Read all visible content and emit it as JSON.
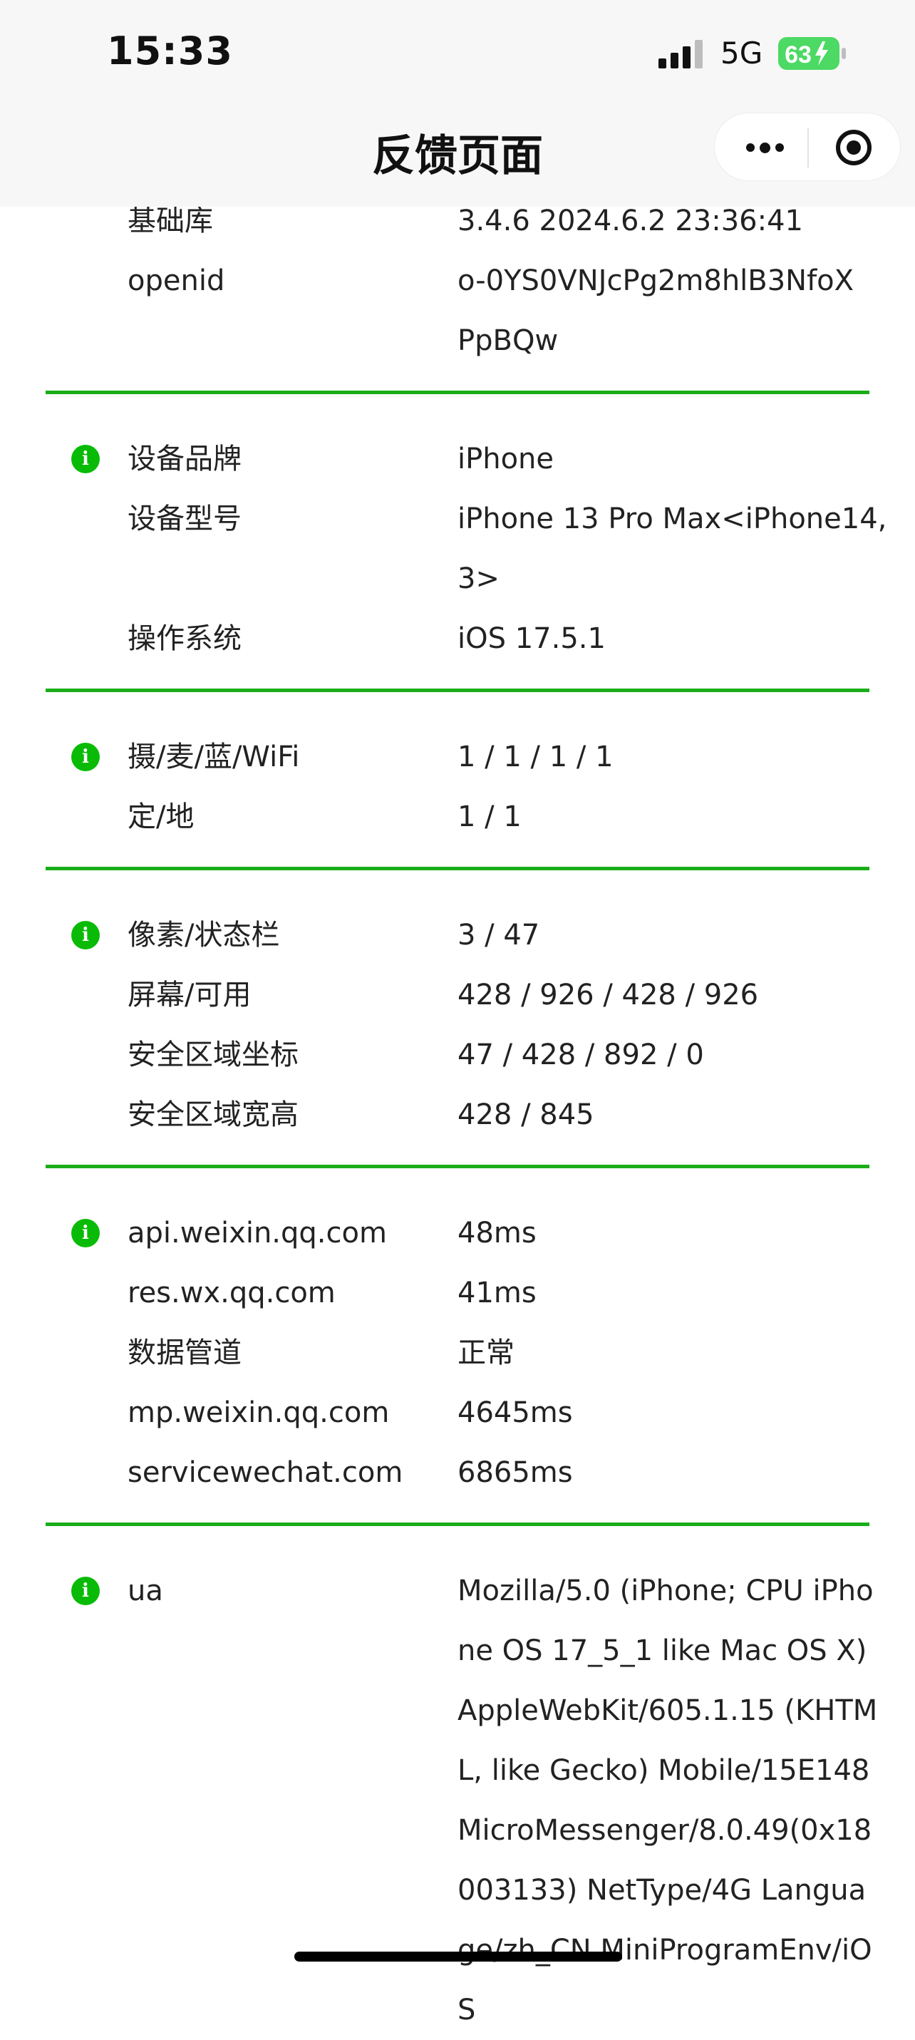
{
  "status_bar": {
    "time": "15:33",
    "network": "5G",
    "battery": "63"
  },
  "nav": {
    "title": "反馈页面"
  },
  "sections": [
    {
      "rows": [
        {
          "label": "基础库",
          "value_lines": [
            "3.4.6 2024.6.2 23:36:41"
          ]
        },
        {
          "label": "openid",
          "value_lines": [
            "o-0YS0VNJcPg2m8hlB3NfoX",
            "PpBQw"
          ]
        }
      ]
    },
    {
      "rows": [
        {
          "label": "设备品牌",
          "value_lines": [
            "iPhone"
          ]
        },
        {
          "label": "设备型号",
          "value_lines": [
            "iPhone 13 Pro Max<iPhone14,",
            "3>"
          ]
        },
        {
          "label": "操作系统",
          "value_lines": [
            "iOS 17.5.1"
          ]
        }
      ]
    },
    {
      "rows": [
        {
          "label": "摄/麦/蓝/WiFi",
          "value_lines": [
            "1 / 1 / 1 / 1"
          ]
        },
        {
          "label": "定/地",
          "value_lines": [
            "1 / 1"
          ]
        }
      ]
    },
    {
      "rows": [
        {
          "label": "像素/状态栏",
          "value_lines": [
            "3 / 47"
          ]
        },
        {
          "label": "屏幕/可用",
          "value_lines": [
            "428 / 926 / 428 / 926"
          ]
        },
        {
          "label": "安全区域坐标",
          "value_lines": [
            "47 / 428 / 892 / 0"
          ]
        },
        {
          "label": "安全区域宽高",
          "value_lines": [
            "428 / 845"
          ]
        }
      ]
    },
    {
      "rows": [
        {
          "label": "api.weixin.qq.com",
          "value_lines": [
            "48ms"
          ]
        },
        {
          "label": "res.wx.qq.com",
          "value_lines": [
            "41ms"
          ]
        },
        {
          "label": "数据管道",
          "value_lines": [
            "正常"
          ]
        },
        {
          "label": "mp.weixin.qq.com",
          "value_lines": [
            "4645ms"
          ]
        },
        {
          "label": "servicewechat.com",
          "value_lines": [
            "6865ms"
          ]
        }
      ]
    },
    {
      "rows": [
        {
          "label": "ua",
          "value_lines": [
            "Mozilla/5.0 (iPhone; CPU iPho",
            "ne OS 17_5_1 like Mac OS X)",
            "AppleWebKit/605.1.15 (KHTM",
            "L, like Gecko) Mobile/15E148",
            "MicroMessenger/8.0.49(0x18",
            "003133) NetType/4G Langua",
            "ge/zh_CN MiniProgramEnv/iO",
            "S"
          ]
        }
      ]
    }
  ],
  "info_icon_glyph": "i",
  "colors": {
    "accent": "#1aad19",
    "icon": "#09bb07",
    "battery": "#4cd964"
  }
}
